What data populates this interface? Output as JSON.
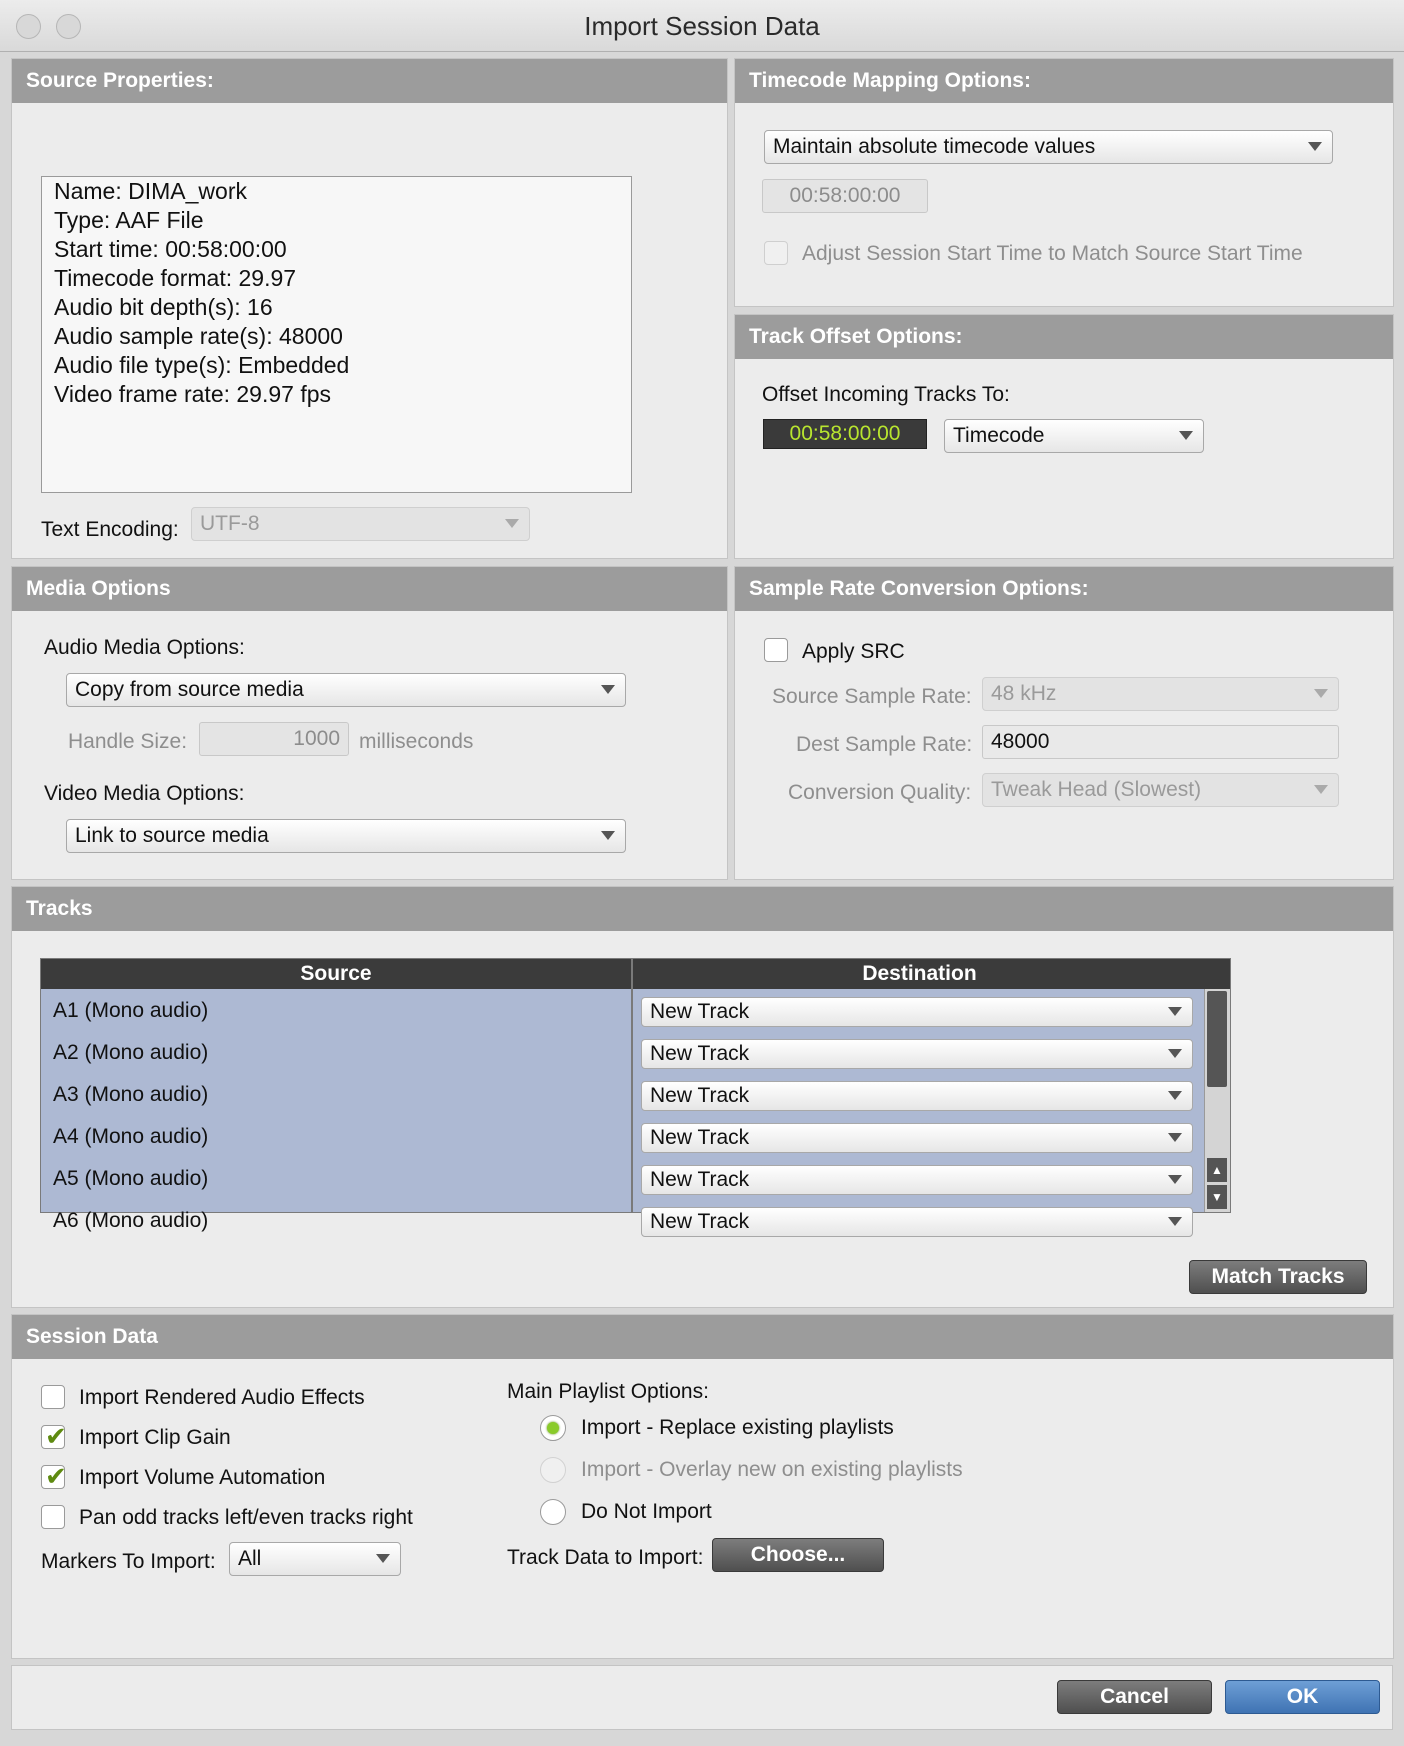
{
  "window": {
    "title": "Import Session Data"
  },
  "source_properties": {
    "header": "Source Properties:",
    "lines": [
      "Name: DIMA_work",
      "Type: AAF File",
      "Start time: 00:58:00:00",
      "Timecode format: 29.97",
      "Audio bit depth(s): 16",
      "Audio sample rate(s): 48000",
      "Audio file type(s): Embedded",
      "Video frame rate: 29.97 fps"
    ],
    "text_encoding_label": "Text Encoding:",
    "text_encoding_value": "UTF-8"
  },
  "timecode_mapping": {
    "header": "Timecode Mapping Options:",
    "mapping_value": "Maintain absolute timecode values",
    "timecode_value": "00:58:00:00",
    "adjust_label": "Adjust Session Start Time to Match Source Start Time"
  },
  "track_offset": {
    "header": "Track Offset Options:",
    "offset_label": "Offset Incoming Tracks To:",
    "offset_value": "00:58:00:00",
    "offset_unit": "Timecode"
  },
  "media_options": {
    "header": "Media Options",
    "audio_label": "Audio Media Options:",
    "audio_value": "Copy from source media",
    "handle_label": "Handle Size:",
    "handle_value": "1000",
    "handle_unit": "milliseconds",
    "video_label": "Video Media Options:",
    "video_value": "Link to source media"
  },
  "src_options": {
    "header": "Sample Rate Conversion Options:",
    "apply_label": "Apply SRC",
    "source_rate_label": "Source Sample Rate:",
    "source_rate_value": "48 kHz",
    "dest_rate_label": "Dest Sample Rate:",
    "dest_rate_value": "48000",
    "quality_label": "Conversion Quality:",
    "quality_value": "Tweak Head (Slowest)"
  },
  "tracks": {
    "header": "Tracks",
    "col_source": "Source",
    "col_destination": "Destination",
    "rows": [
      {
        "source": "A1 (Mono audio)",
        "destination": "New Track"
      },
      {
        "source": "A2 (Mono audio)",
        "destination": "New Track"
      },
      {
        "source": "A3 (Mono audio)",
        "destination": "New Track"
      },
      {
        "source": "A4 (Mono audio)",
        "destination": "New Track"
      },
      {
        "source": "A5 (Mono audio)",
        "destination": "New Track"
      },
      {
        "source": "A6 (Mono audio)",
        "destination": "New Track"
      }
    ],
    "match_button": "Match Tracks"
  },
  "session_data": {
    "header": "Session Data",
    "checkboxes": [
      {
        "label": "Import Rendered Audio Effects",
        "checked": false
      },
      {
        "label": "Import Clip Gain",
        "checked": true
      },
      {
        "label": "Import Volume Automation",
        "checked": true
      },
      {
        "label": "Pan odd tracks left/even tracks right",
        "checked": false
      }
    ],
    "markers_label": "Markers To Import:",
    "markers_value": "All",
    "playlist_label": "Main Playlist Options:",
    "playlist_options": [
      {
        "label": "Import - Replace existing playlists",
        "selected": true,
        "enabled": true
      },
      {
        "label": "Import - Overlay new on existing playlists",
        "selected": false,
        "enabled": false
      },
      {
        "label": "Do Not Import",
        "selected": false,
        "enabled": true
      }
    ],
    "track_data_label": "Track Data to Import:",
    "choose_button": "Choose..."
  },
  "footer": {
    "cancel": "Cancel",
    "ok": "OK"
  },
  "colors": {
    "header_bg": "#9c9c9c",
    "panel_bg": "#ececec",
    "tracks_bg": "#adb9d3",
    "timecode_green": "#b8e52f",
    "ok_blue": "#3f73b3",
    "check_green": "#8acb2a"
  }
}
